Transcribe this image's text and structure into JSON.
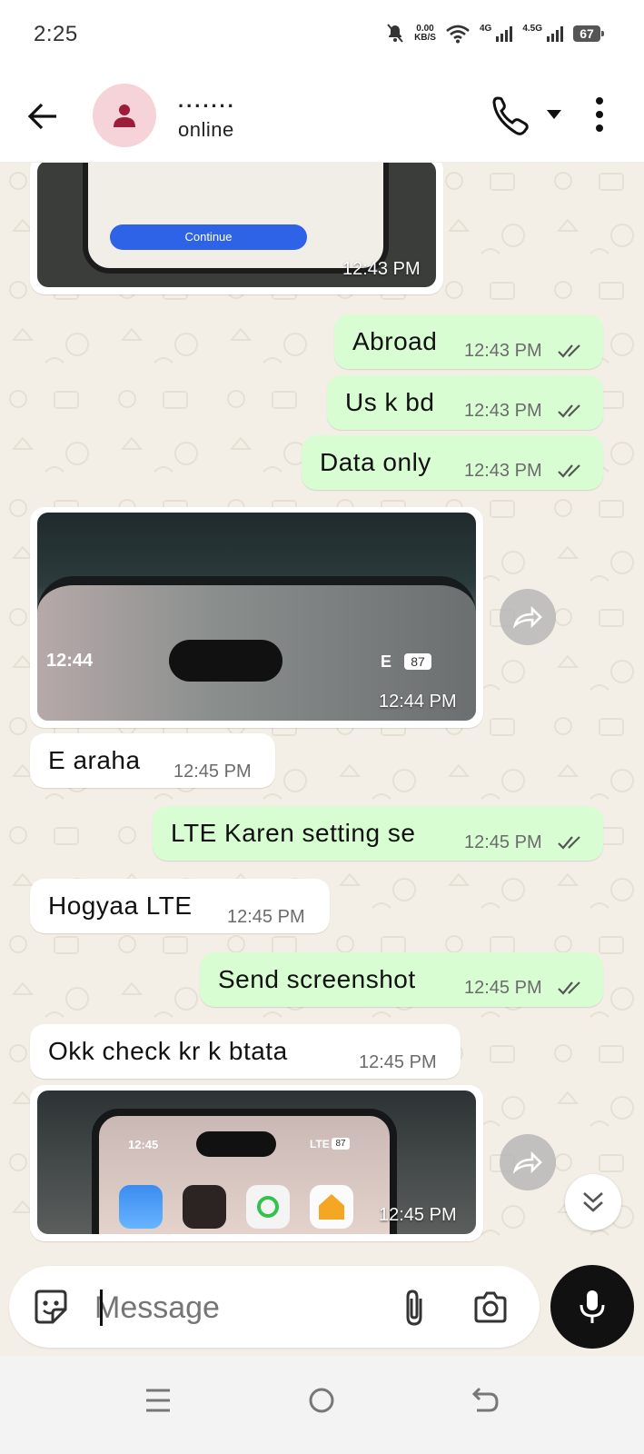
{
  "status_bar": {
    "time": "2:25",
    "speed_value": "0.00",
    "speed_unit": "KB/S",
    "net1": "4G",
    "net2": "4.5G",
    "battery": "67"
  },
  "header": {
    "contact_name": ".......",
    "contact_status": "online"
  },
  "messages": [
    {
      "type": "image",
      "direction": "in",
      "image_text": "Continue",
      "time": "12:43 PM"
    },
    {
      "type": "text",
      "direction": "out",
      "text": "Abroad",
      "time": "12:43 PM",
      "read": true
    },
    {
      "type": "text",
      "direction": "out",
      "text": "Us k bd",
      "time": "12:43 PM",
      "read": true
    },
    {
      "type": "text",
      "direction": "out",
      "text": "Data only",
      "time": "12:43 PM",
      "read": true
    },
    {
      "type": "image",
      "direction": "in",
      "image_clock": "12:44",
      "image_net": "E",
      "image_battery": "87",
      "time": "12:44 PM"
    },
    {
      "type": "text",
      "direction": "in",
      "text": "E araha",
      "time": "12:45 PM"
    },
    {
      "type": "text",
      "direction": "out",
      "text": "LTE Karen setting se",
      "time": "12:45 PM",
      "read": true
    },
    {
      "type": "text",
      "direction": "in",
      "text": "Hogyaa LTE",
      "time": "12:45 PM"
    },
    {
      "type": "text",
      "direction": "out",
      "text": "Send screenshot",
      "time": "12:45 PM",
      "read": true
    },
    {
      "type": "text",
      "direction": "in",
      "text": "Okk check kr k btata",
      "time": "12:45 PM"
    },
    {
      "type": "image",
      "direction": "in",
      "image_clock": "12:45",
      "image_net": "LTE",
      "image_battery": "87",
      "time": "12:45 PM"
    }
  ],
  "composer": {
    "placeholder": "Message"
  },
  "colors": {
    "chat_background": "#f4efe6",
    "outgoing_bubble": "#d9fdd3",
    "incoming_bubble": "#ffffff",
    "avatar_bg": "#f5d3d8",
    "avatar_icon": "#9b1d3a"
  }
}
